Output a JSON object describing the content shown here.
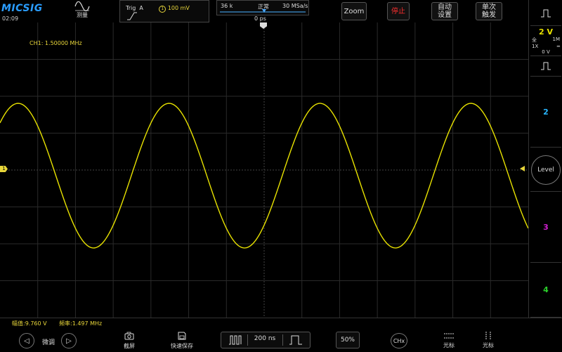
{
  "header": {
    "logo": "MICSIG",
    "time": "02:09",
    "measure_label": "测量",
    "trigger": {
      "label": "Trig",
      "source": "A",
      "channel": "1",
      "level": "100 mV"
    },
    "acquisition": {
      "memory": "36 k",
      "mode": "正常",
      "sample_rate": "30 MSa/s",
      "offset": "0 ps"
    },
    "zoom_label": "Zoom",
    "stop_label": "停止",
    "auto_label_1": "自动",
    "auto_label_2": "设置",
    "single_label_1": "单次",
    "single_label_2": "触发"
  },
  "screen": {
    "freq_readout": "CH1: 1.50000 MHz",
    "ch1_marker": "1",
    "trace_color": "#e8e200",
    "grid_color": "#2a2a2a"
  },
  "right_panel": {
    "ch1_scale": "2 V",
    "ch1_coupling": "全",
    "ch1_probe": "1X",
    "ch1_impedance": "1M",
    "ch1_offset": "0 V",
    "ch2": "2",
    "level_label": "Level",
    "ch3": "3",
    "ch4": "4",
    "ch2_color": "#29b6ff",
    "ch3_color": "#d01fd0",
    "ch4_color": "#2bd12b"
  },
  "bottom": {
    "amplitude": "幅值:9.760 V",
    "frequency": "频率:1.497 MHz",
    "fine_adjust": "微调",
    "screenshot": "截屏",
    "quick_save": "快速保存",
    "timebase": "200 ns",
    "percent": "50%",
    "chx": "CHx",
    "cursor_h": "光标",
    "cursor_v": "光标"
  },
  "waveform": {
    "cycles_on_screen": 3.5,
    "amplitude_fraction": 0.5
  }
}
